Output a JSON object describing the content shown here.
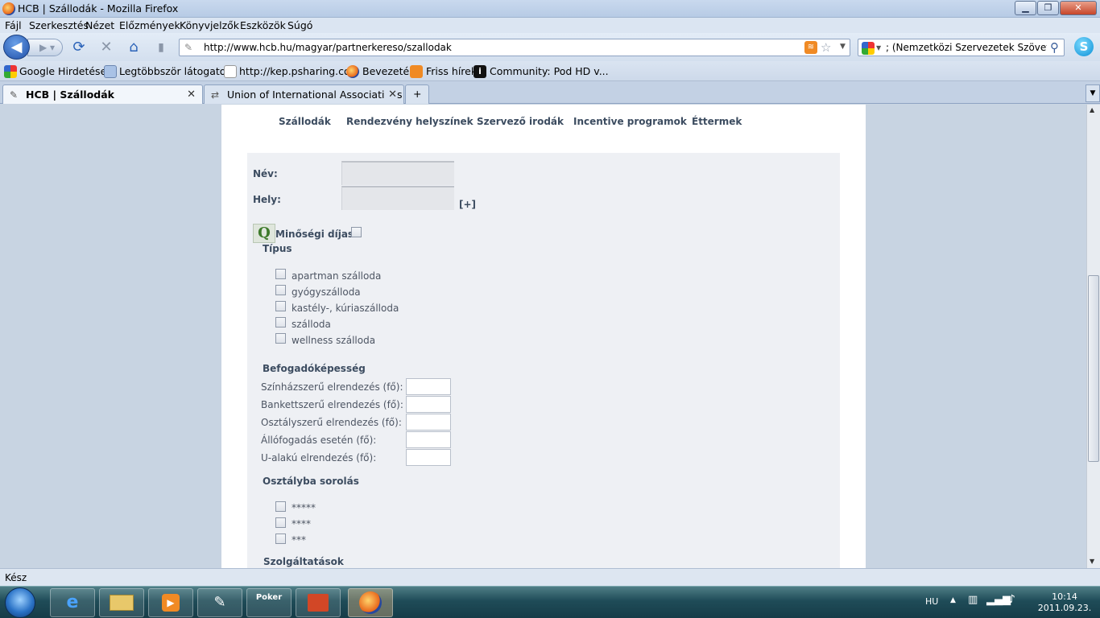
{
  "window": {
    "title": "HCB | Szállodák - Mozilla Firefox"
  },
  "menu": [
    "Fájl",
    "Szerkesztés",
    "Nézet",
    "Előzmények",
    "Könyvjelzők",
    "Eszközök",
    "Súgó"
  ],
  "address": {
    "url": "http://www.hcb.hu/magyar/partnerkereso/szallodak"
  },
  "search": {
    "value": "; (Nemzetközi Szervezetek Szövetsége)"
  },
  "bookmarks": [
    "Google Hirdetések",
    "Legtöbbször látogatott",
    "http://kep.psharing.co...",
    "Bevezetés",
    "Friss hírek",
    "Community: Pod HD v..."
  ],
  "tabs": [
    {
      "label": "HCB | Szállodák",
      "active": true
    },
    {
      "label": "Union of International Associations |",
      "active": false
    }
  ],
  "site_nav": [
    "Szállodák",
    "Rendezvény helyszínek",
    "Szervező irodák",
    "Incentive programok",
    "Éttermek"
  ],
  "form": {
    "name_label": "Név:",
    "place_label": "Hely:",
    "more_link": "[+]",
    "quality_icon": "Q",
    "quality_label": "Minőségi díjas:",
    "type_heading": "Típus",
    "types": [
      "apartman szálloda",
      "gyógyszálloda",
      "kastély-, kúriaszálloda",
      "szálloda",
      "wellness szálloda"
    ],
    "capacity_heading": "Befogadóképesség",
    "capacity_fields": [
      "Színházszerű elrendezés (fő):",
      "Bankettszerű elrendezés (fő):",
      "Osztályszerű elrendezés (fő):",
      "Állófogadás esetén (fő):",
      "U-alakú elrendezés (fő):"
    ],
    "class_heading": "Osztályba sorolás",
    "classes": [
      "*****",
      "****",
      "***"
    ],
    "services_heading": "Szolgáltatások"
  },
  "status": {
    "text": "Kész"
  },
  "taskbar": {
    "poker_label": "Poker",
    "lang": "HU",
    "time": "10:14",
    "date": "2011.09.23."
  },
  "colors": {
    "accent": "#3c4c60",
    "panel": "#eef0f4",
    "page_bg": "#c8d4e2"
  }
}
